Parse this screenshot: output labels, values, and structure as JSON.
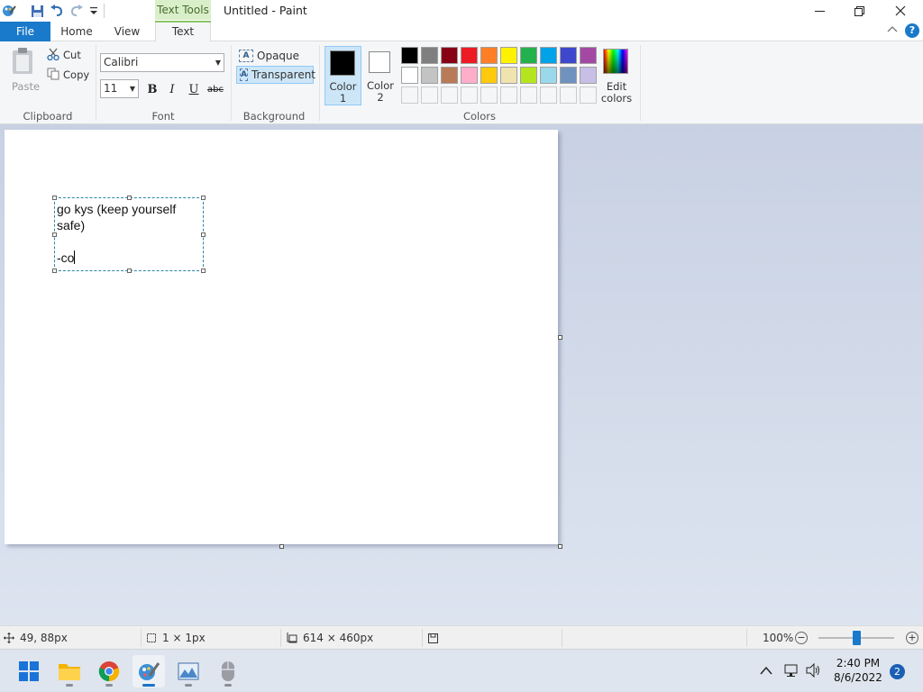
{
  "window": {
    "contextual_tab": "Text Tools",
    "title": "Untitled - Paint"
  },
  "tabs": {
    "file": "File",
    "home": "Home",
    "view": "View",
    "text": "Text"
  },
  "ribbon": {
    "clipboard": {
      "paste": "Paste",
      "cut": "Cut",
      "copy": "Copy",
      "label": "Clipboard"
    },
    "font": {
      "family": "Calibri",
      "size": "11",
      "bold": "B",
      "italic": "I",
      "underline": "U",
      "strike": "abc",
      "label": "Font"
    },
    "background": {
      "opaque": "Opaque",
      "transparent": "Transparent",
      "label": "Background"
    },
    "colors": {
      "color1_label": "Color\n1",
      "color2_label": "Color\n2",
      "edit_label": "Edit\ncolors",
      "label": "Colors",
      "color1": "#000000",
      "color2": "#ffffff",
      "palette_row1": [
        "#000000",
        "#7f7f7f",
        "#880015",
        "#ed1c24",
        "#ff7f27",
        "#fff200",
        "#22b14c",
        "#00a2e8",
        "#3f48cc",
        "#a349a4"
      ],
      "palette_row2": [
        "#ffffff",
        "#c3c3c3",
        "#b97a57",
        "#ffaec9",
        "#ffc90e",
        "#efe4b0",
        "#b5e61d",
        "#99d9ea",
        "#7092be",
        "#c8bfe7"
      ]
    }
  },
  "canvas": {
    "text": "go kys (keep yourself safe)\n\n-co"
  },
  "status": {
    "cursor_pos": "49, 88px",
    "selection_size": "1 × 1px",
    "image_size": "614 × 460px",
    "zoom": "100%"
  },
  "taskbar": {
    "time": "2:40 PM",
    "date": "8/6/2022",
    "notifications": "2"
  }
}
